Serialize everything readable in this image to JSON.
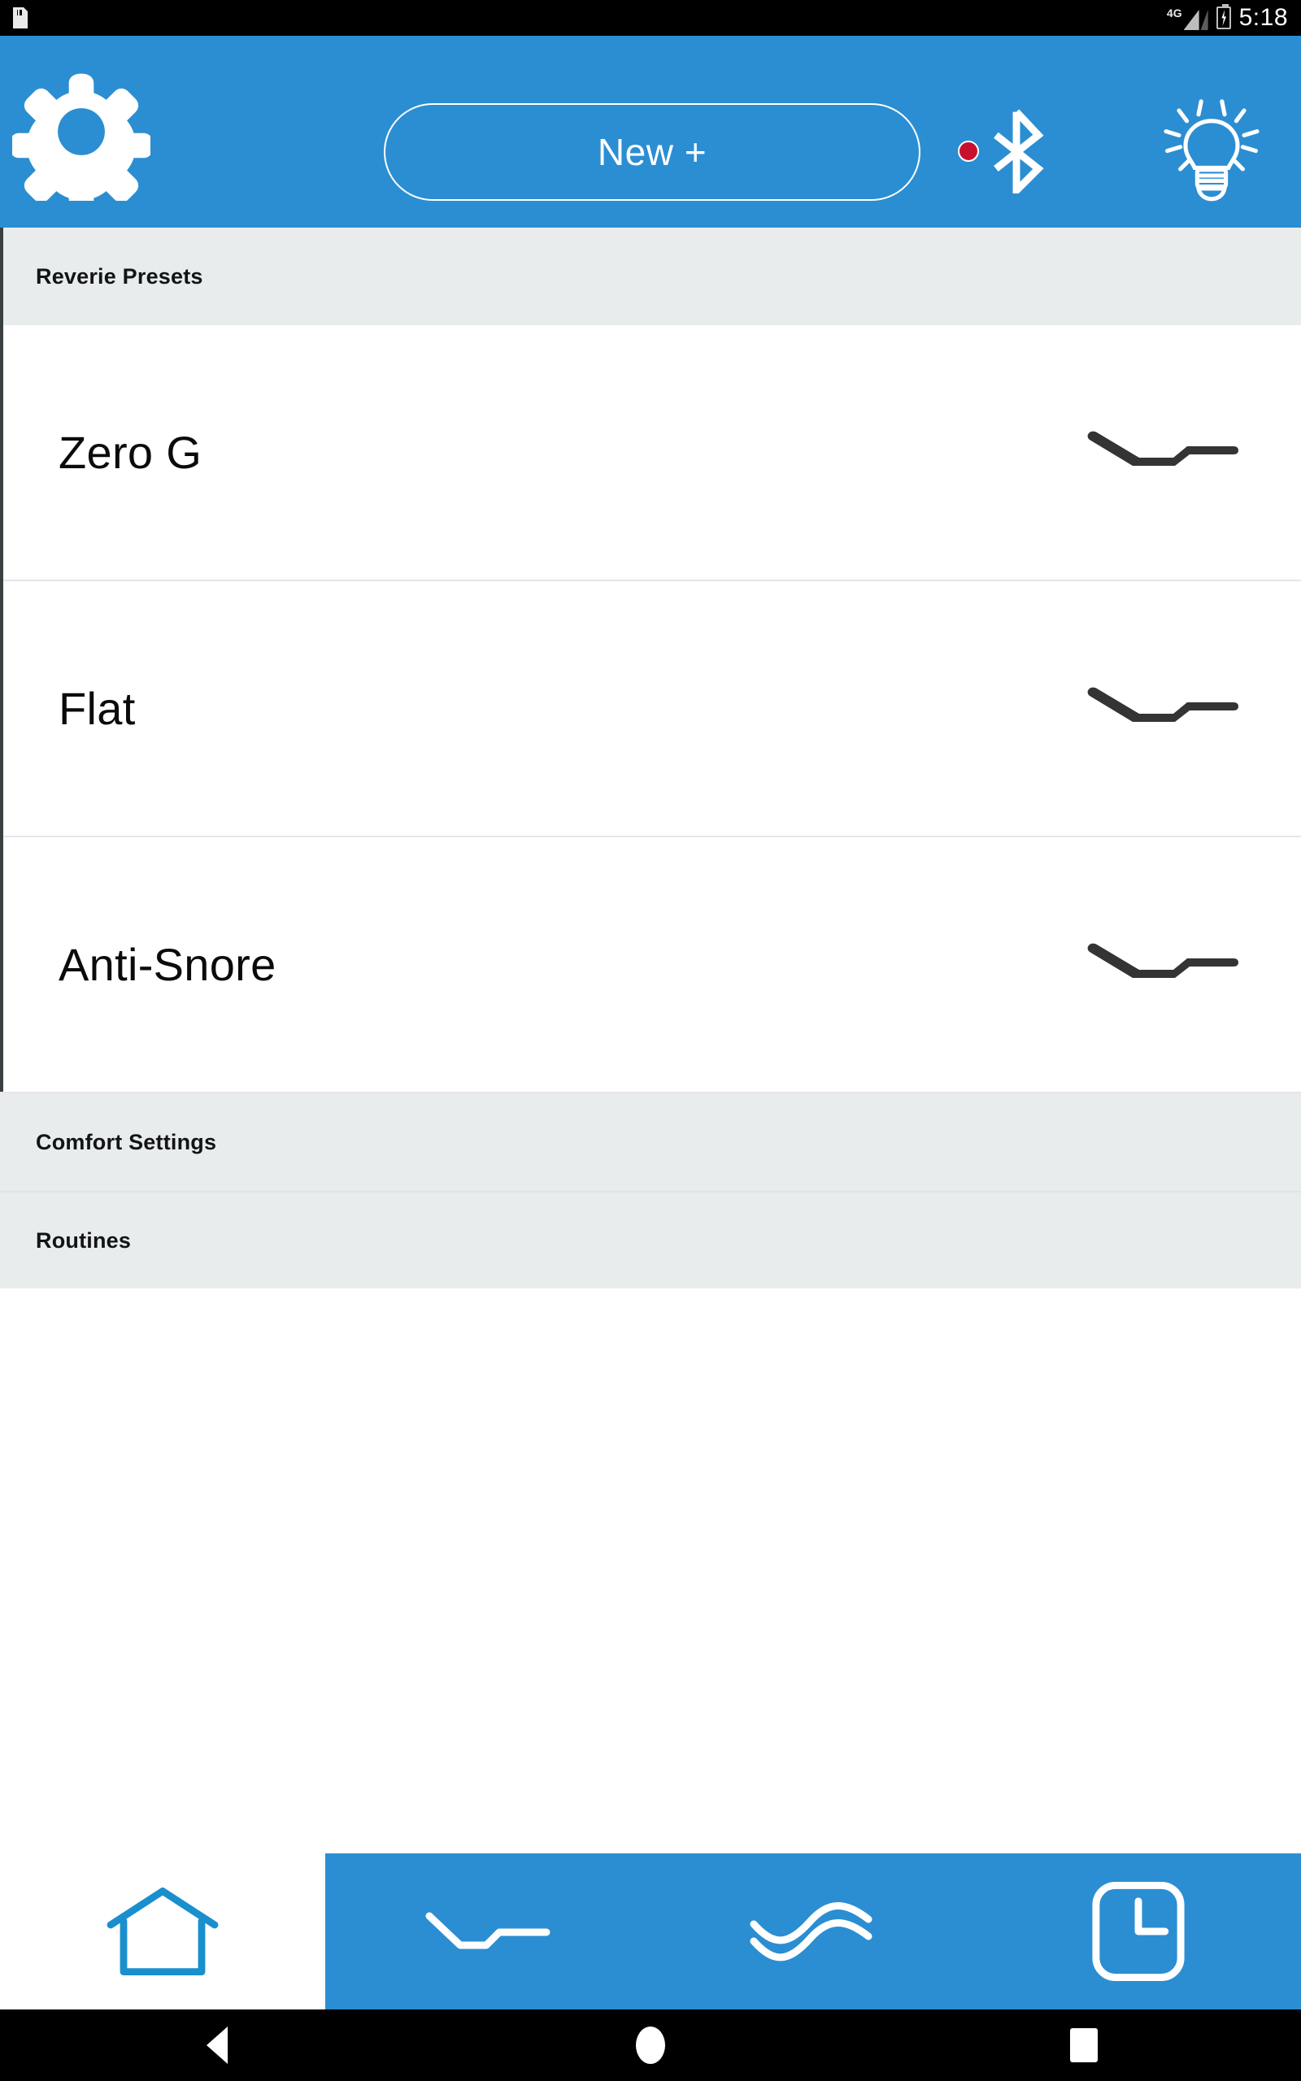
{
  "status_bar": {
    "sd_card_icon": "sd-card-icon",
    "network_label": "4G",
    "signal_icon": "signal-bars-icon",
    "battery_icon": "battery-charging-icon",
    "time": "5:18"
  },
  "app_bar": {
    "settings_icon": "gear-icon",
    "new_button_label": "New +",
    "bluetooth_icon": "bluetooth-icon",
    "bluetooth_status_color": "#c8102e",
    "light_icon": "lightbulb-icon",
    "background_color": "#2b8ed2"
  },
  "content": {
    "presets_section": {
      "title": "Reverie Presets",
      "items": [
        {
          "name": "Zero G",
          "icon": "bed-position-icon"
        },
        {
          "name": "Flat",
          "icon": "bed-position-icon"
        },
        {
          "name": "Anti-Snore",
          "icon": "bed-position-icon"
        }
      ]
    },
    "collapsed_sections": [
      {
        "title": "Comfort Settings"
      },
      {
        "title": "Routines"
      }
    ],
    "section_header_color": "#e8ecec"
  },
  "bottom_nav": {
    "items": [
      {
        "icon": "home-icon",
        "active": false
      },
      {
        "icon": "bed-position-icon",
        "active": true
      },
      {
        "icon": "massage-wave-icon",
        "active": true
      },
      {
        "icon": "clock-icon",
        "active": true
      }
    ],
    "active_color": "#2b8ed2",
    "inactive_icon_color": "#1a8fce"
  },
  "android_nav": {
    "back_icon": "back-triangle-icon",
    "home_icon": "home-circle-icon",
    "recents_icon": "recents-square-icon"
  }
}
